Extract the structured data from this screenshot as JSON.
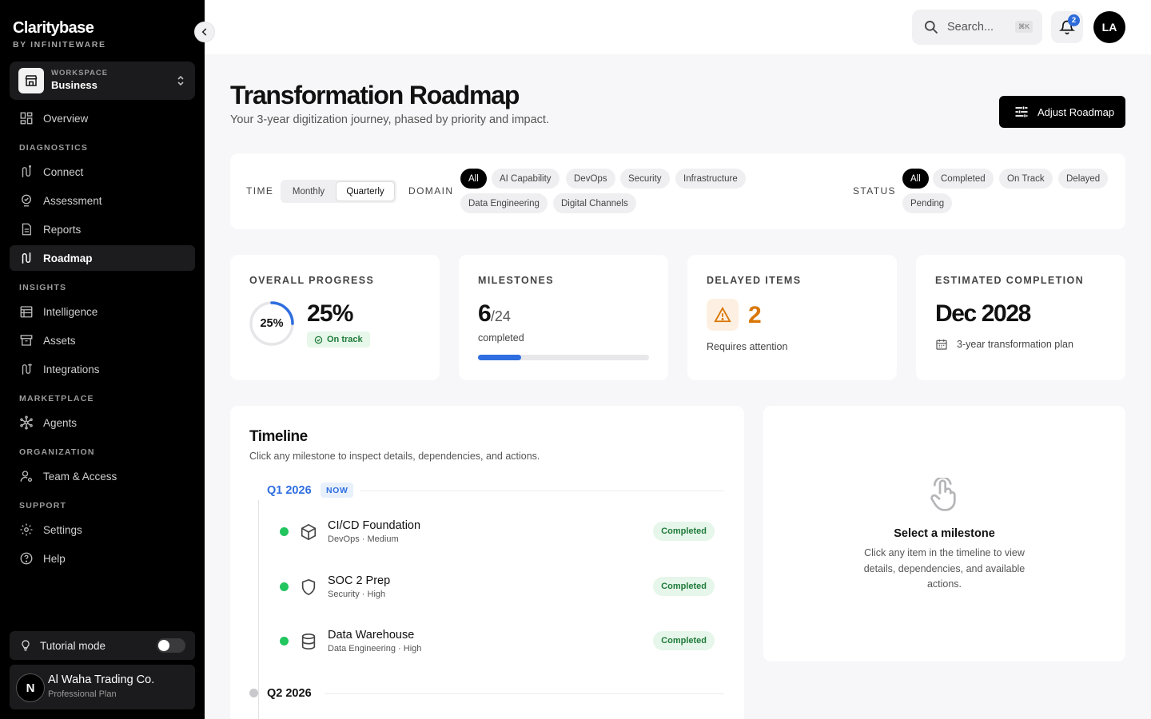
{
  "brand": {
    "name": "Claritybase",
    "by": "BY INFINITEWARE"
  },
  "workspace": {
    "label": "WORKSPACE",
    "value": "Business"
  },
  "sidebar": {
    "overview": "Overview",
    "sections": [
      "DIAGNOSTICS",
      "INSIGHTS",
      "MARKETPLACE",
      "ORGANIZATION",
      "SUPPORT"
    ],
    "items": [
      "Connect",
      "Assessment",
      "Reports",
      "Roadmap",
      "Intelligence",
      "Assets",
      "Integrations",
      "Agents",
      "Team & Access",
      "Settings",
      "Help"
    ],
    "active": "Roadmap",
    "tutorial": "Tutorial mode",
    "org_name": "Al Waha Trading Co.",
    "org_plan": "Professional Plan",
    "org_initial": "N"
  },
  "topbar": {
    "search_placeholder": "Search...",
    "shortcut": "⌘K",
    "notifications": "2",
    "user_initials": "LA"
  },
  "page": {
    "title": "Transformation Roadmap",
    "subtitle": "Your 3-year digitization journey, phased by priority and impact.",
    "adjust_button": "Adjust Roadmap"
  },
  "filters": {
    "time_label": "TIME",
    "time_options": [
      "Monthly",
      "Quarterly"
    ],
    "time_selected": "Quarterly",
    "domain_label": "DOMAIN",
    "domains": [
      "All",
      "AI Capability",
      "DevOps",
      "Security",
      "Infrastructure",
      "Data Engineering",
      "Digital Channels"
    ],
    "status_label": "STATUS",
    "statuses": [
      "All",
      "Completed",
      "On Track",
      "Delayed",
      "Pending"
    ]
  },
  "stats": {
    "progress": {
      "label": "OVERALL PROGRESS",
      "value": "25%",
      "percent": 25,
      "ring_text": "25%",
      "status": "On track"
    },
    "milestones": {
      "label": "MILESTONES",
      "done": "6",
      "total": "/24",
      "caption": "completed",
      "fraction": 0.25
    },
    "delayed": {
      "label": "DELAYED ITEMS",
      "value": "2",
      "caption": "Requires attention"
    },
    "completion": {
      "label": "ESTIMATED COMPLETION",
      "value": "Dec 2028",
      "caption": "3-year transformation plan"
    }
  },
  "timeline": {
    "title": "Timeline",
    "description": "Click any milestone to inspect details, dependencies, and actions.",
    "quarters": [
      {
        "label": "Q1 2026",
        "badge": "NOW",
        "milestones": [
          {
            "name": "CI/CD Foundation",
            "meta": "DevOps · Medium",
            "status": "Completed",
            "icon": "cube-icon"
          },
          {
            "name": "SOC 2 Prep",
            "meta": "Security · High",
            "status": "Completed",
            "icon": "shield-icon"
          },
          {
            "name": "Data Warehouse",
            "meta": "Data Engineering · High",
            "status": "Completed",
            "icon": "database-icon"
          }
        ]
      },
      {
        "label": "Q2 2026"
      }
    ]
  },
  "detail": {
    "title": "Select a milestone",
    "description": "Click any item in the timeline to view details, dependencies, and available actions."
  },
  "colors": {
    "accent": "#2f6ee0",
    "success": "#22c55e",
    "warning": "#d97706",
    "sidebar": "#000000"
  }
}
